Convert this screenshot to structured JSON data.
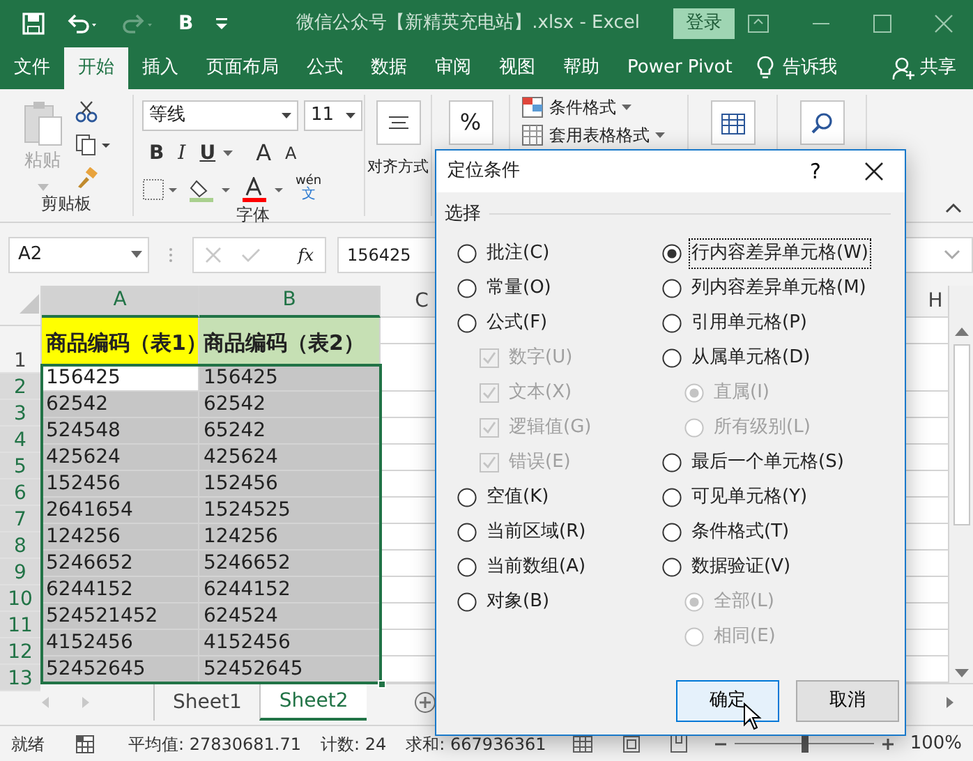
{
  "window": {
    "quick_access_label": "B",
    "title": "微信公众号【新精英充电站】.xlsx  -  Excel",
    "login": "登录"
  },
  "tabs": [
    {
      "label": "文件",
      "selected": false
    },
    {
      "label": "开始",
      "selected": true
    },
    {
      "label": "插入",
      "selected": false
    },
    {
      "label": "页面布局",
      "selected": false
    },
    {
      "label": "公式",
      "selected": false
    },
    {
      "label": "数据",
      "selected": false
    },
    {
      "label": "审阅",
      "selected": false
    },
    {
      "label": "视图",
      "selected": false
    },
    {
      "label": "帮助",
      "selected": false
    },
    {
      "label": "Power Pivot",
      "selected": false
    }
  ],
  "tell_me": "告诉我",
  "share": "共享",
  "ribbon": {
    "paste": "粘贴",
    "clipboard_group": "剪贴板",
    "font_name": "等线",
    "font_size": "11",
    "font_styles": [
      "B",
      "I",
      "U"
    ],
    "grow_font": "A",
    "shrink_font": "A",
    "phonetic_top": "wén",
    "phonetic_bottom": "文",
    "font_group": "字体",
    "alignment_group": "对齐方式",
    "percent": "%",
    "conditional_format": "条件格式",
    "table_format": "套用表格格式"
  },
  "formula_bar": {
    "name_box": "A2",
    "fx": "fx",
    "value": "156425"
  },
  "sheet": {
    "columns": [
      "A",
      "B",
      "C",
      "H"
    ],
    "header_row": {
      "number": "1",
      "cells": [
        {
          "text": "商品编码（表1）",
          "color": "#ffff00"
        },
        {
          "text": "商品编码（表2）",
          "color": "#c6e0b4"
        }
      ]
    },
    "rows": [
      {
        "number": "2",
        "selected": true,
        "cells": [
          {
            "text": "156425",
            "selected": false
          },
          {
            "text": "156425",
            "selected": true
          }
        ]
      },
      {
        "number": "3",
        "selected": true,
        "cells": [
          {
            "text": "62542",
            "selected": true
          },
          {
            "text": "62542",
            "selected": true
          }
        ]
      },
      {
        "number": "4",
        "selected": true,
        "cells": [
          {
            "text": "524548",
            "selected": true
          },
          {
            "text": "65242",
            "selected": true
          }
        ]
      },
      {
        "number": "5",
        "selected": true,
        "cells": [
          {
            "text": "425624",
            "selected": true
          },
          {
            "text": "425624",
            "selected": true
          }
        ]
      },
      {
        "number": "6",
        "selected": true,
        "cells": [
          {
            "text": "152456",
            "selected": true
          },
          {
            "text": "152456",
            "selected": true
          }
        ]
      },
      {
        "number": "7",
        "selected": true,
        "cells": [
          {
            "text": "2641654",
            "selected": true
          },
          {
            "text": "1524525",
            "selected": true
          }
        ]
      },
      {
        "number": "8",
        "selected": true,
        "cells": [
          {
            "text": "124256",
            "selected": true
          },
          {
            "text": "124256",
            "selected": true
          }
        ]
      },
      {
        "number": "9",
        "selected": true,
        "cells": [
          {
            "text": "5246652",
            "selected": true
          },
          {
            "text": "5246652",
            "selected": true
          }
        ]
      },
      {
        "number": "10",
        "selected": true,
        "cells": [
          {
            "text": "6244152",
            "selected": true
          },
          {
            "text": "6244152",
            "selected": true
          }
        ]
      },
      {
        "number": "11",
        "selected": true,
        "cells": [
          {
            "text": "524521452",
            "selected": true
          },
          {
            "text": "624524",
            "selected": true
          }
        ]
      },
      {
        "number": "12",
        "selected": true,
        "cells": [
          {
            "text": "4152456",
            "selected": true
          },
          {
            "text": "4152456",
            "selected": true
          }
        ]
      },
      {
        "number": "13",
        "selected": true,
        "cells": [
          {
            "text": "52452645",
            "selected": true
          },
          {
            "text": "52452645",
            "selected": true
          }
        ]
      }
    ]
  },
  "sheet_tabs": [
    {
      "label": "Sheet1",
      "selected": false
    },
    {
      "label": "Sheet2",
      "selected": true
    }
  ],
  "status_bar": {
    "ready": "就绪",
    "average": "平均值: 27830681.71",
    "count": "计数: 24",
    "sum": "求和: 667936361",
    "zoom": "100%",
    "zoom_slider": {
      "level": 0.5
    }
  },
  "dialog": {
    "title": "定位条件",
    "help": "?",
    "group": "选择",
    "left_options": [
      {
        "label": "批注(C)",
        "kind": "radio",
        "checked": false,
        "disabled": false,
        "focused": false
      },
      {
        "label": "常量(O)",
        "kind": "radio",
        "checked": false,
        "disabled": false,
        "focused": false
      },
      {
        "label": "公式(F)",
        "kind": "radio",
        "checked": false,
        "disabled": false,
        "focused": false,
        "children": [
          {
            "label": "数字(U)",
            "kind": "checkbox",
            "checked": true,
            "disabled": true
          },
          {
            "label": "文本(X)",
            "kind": "checkbox",
            "checked": true,
            "disabled": true
          },
          {
            "label": "逻辑值(G)",
            "kind": "checkbox",
            "checked": true,
            "disabled": true
          },
          {
            "label": "错误(E)",
            "kind": "checkbox",
            "checked": true,
            "disabled": true
          }
        ]
      },
      {
        "label": "空值(K)",
        "kind": "radio",
        "checked": false,
        "disabled": false,
        "focused": false
      },
      {
        "label": "当前区域(R)",
        "kind": "radio",
        "checked": false,
        "disabled": false,
        "focused": false
      },
      {
        "label": "当前数组(A)",
        "kind": "radio",
        "checked": false,
        "disabled": false,
        "focused": false
      },
      {
        "label": "对象(B)",
        "kind": "radio",
        "checked": false,
        "disabled": false,
        "focused": false
      }
    ],
    "right_options": [
      {
        "label": "行内容差异单元格(W)",
        "kind": "radio",
        "checked": true,
        "disabled": false,
        "focused": true
      },
      {
        "label": "列内容差异单元格(M)",
        "kind": "radio",
        "checked": false,
        "disabled": false,
        "focused": false
      },
      {
        "label": "引用单元格(P)",
        "kind": "radio",
        "checked": false,
        "disabled": false,
        "focused": false
      },
      {
        "label": "从属单元格(D)",
        "kind": "radio",
        "checked": false,
        "disabled": false,
        "focused": false,
        "children": [
          {
            "label": "直属(I)",
            "kind": "radio",
            "checked": true,
            "disabled": true
          },
          {
            "label": "所有级别(L)",
            "kind": "radio",
            "checked": false,
            "disabled": true
          }
        ]
      },
      {
        "label": "最后一个单元格(S)",
        "kind": "radio",
        "checked": false,
        "disabled": false,
        "focused": false
      },
      {
        "label": "可见单元格(Y)",
        "kind": "radio",
        "checked": false,
        "disabled": false,
        "focused": false
      },
      {
        "label": "条件格式(T)",
        "kind": "radio",
        "checked": false,
        "disabled": false,
        "focused": false
      },
      {
        "label": "数据验证(V)",
        "kind": "radio",
        "checked": false,
        "disabled": false,
        "focused": false,
        "children": [
          {
            "label": "全部(L)",
            "kind": "radio",
            "checked": true,
            "disabled": true
          },
          {
            "label": "相同(E)",
            "kind": "radio",
            "checked": false,
            "disabled": true
          }
        ]
      }
    ],
    "buttons": [
      {
        "label": "确定",
        "default": true
      },
      {
        "label": "取消",
        "default": false
      }
    ]
  }
}
